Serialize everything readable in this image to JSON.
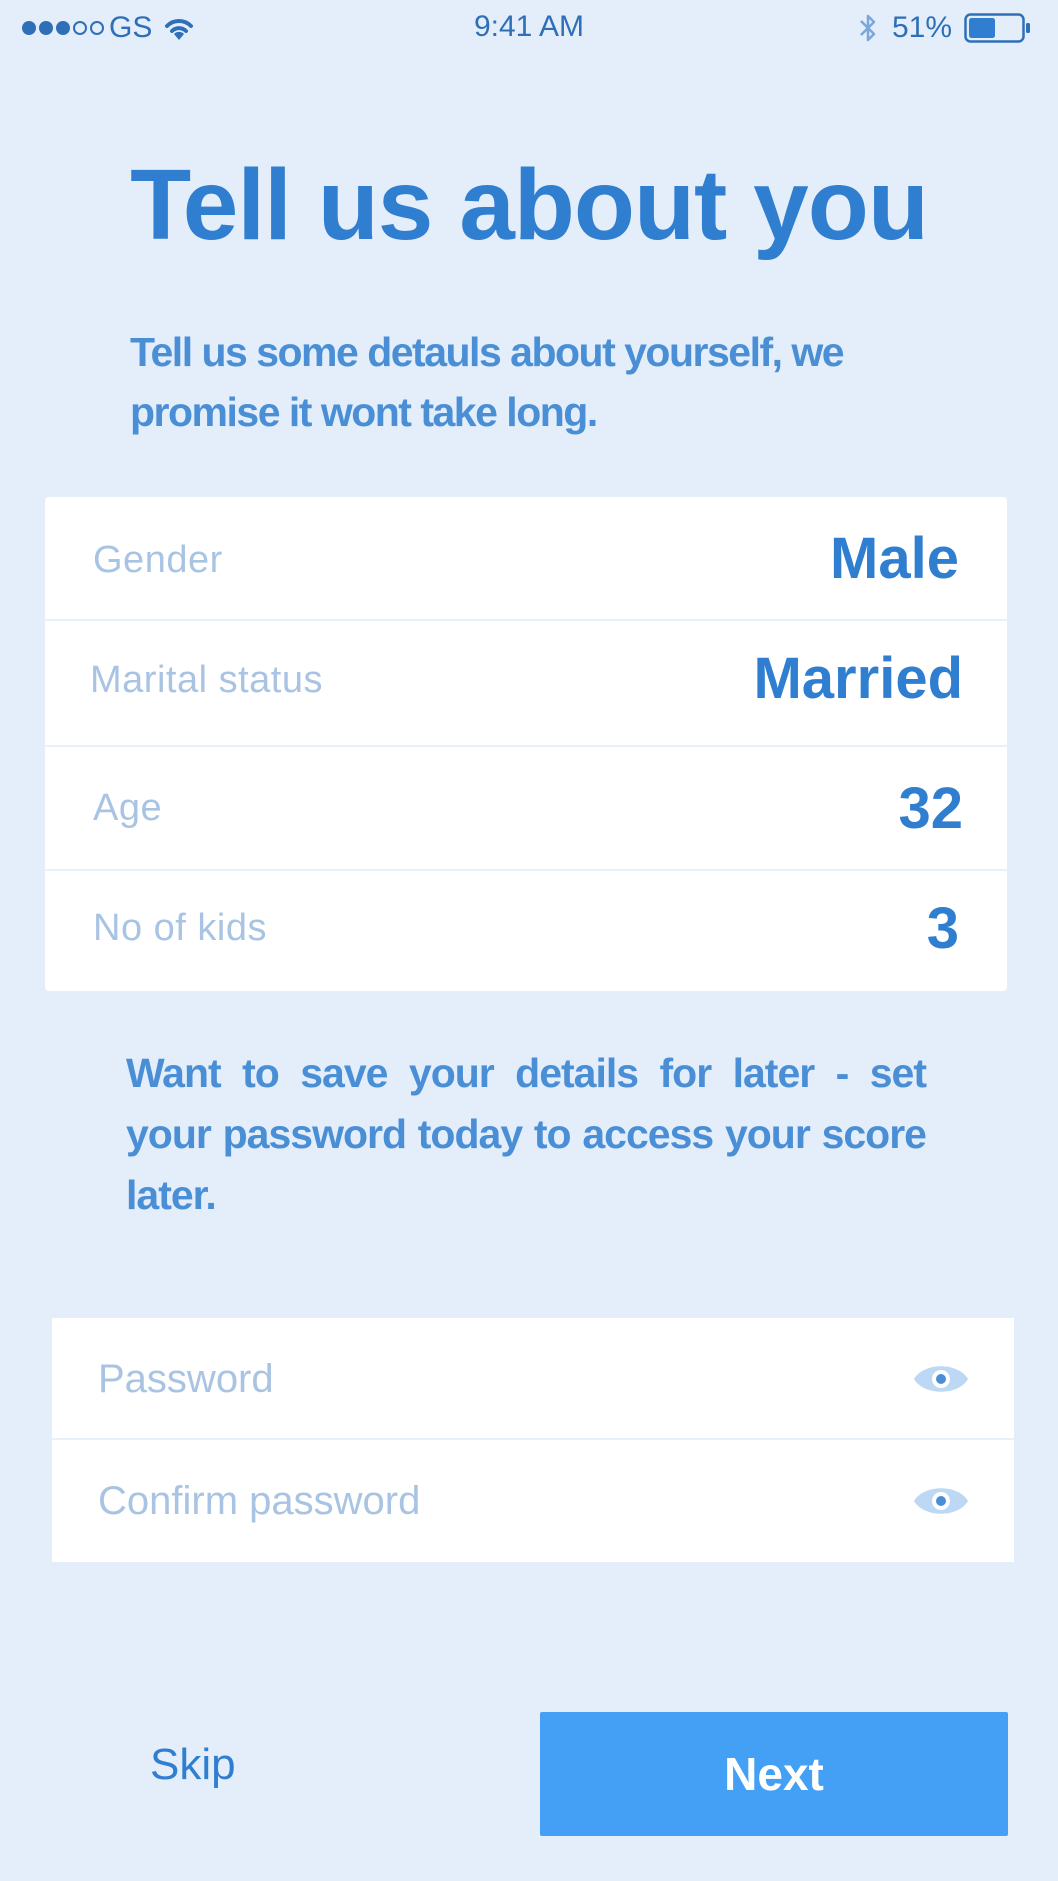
{
  "status_bar": {
    "carrier": "GS",
    "time": "9:41 AM",
    "battery_percent": "51%",
    "battery_level": 0.51,
    "signal_bars_filled": 3,
    "signal_bars_total": 5
  },
  "header": {
    "title": "Tell us about you",
    "subtitle": "Tell us some detauls about yourself, we promise it wont take long."
  },
  "details": [
    {
      "label": "Gender",
      "value": "Male"
    },
    {
      "label": "Marital status",
      "value": "Married"
    },
    {
      "label": "Age",
      "value": "32"
    },
    {
      "label": "No of kids",
      "value": "3"
    }
  ],
  "save_note": "Want to save your details for later - set your password today to access your score later.",
  "password_fields": [
    {
      "placeholder": "Password",
      "value": "",
      "icon": "eye-icon"
    },
    {
      "placeholder": "Confirm password",
      "value": "",
      "icon": "eye-icon"
    }
  ],
  "actions": {
    "skip_label": "Skip",
    "next_label": "Next"
  },
  "colors": {
    "background": "#e3eefa",
    "accent": "#2f7ed0",
    "button": "#43a0f5",
    "muted_label": "#a9c4e3"
  }
}
